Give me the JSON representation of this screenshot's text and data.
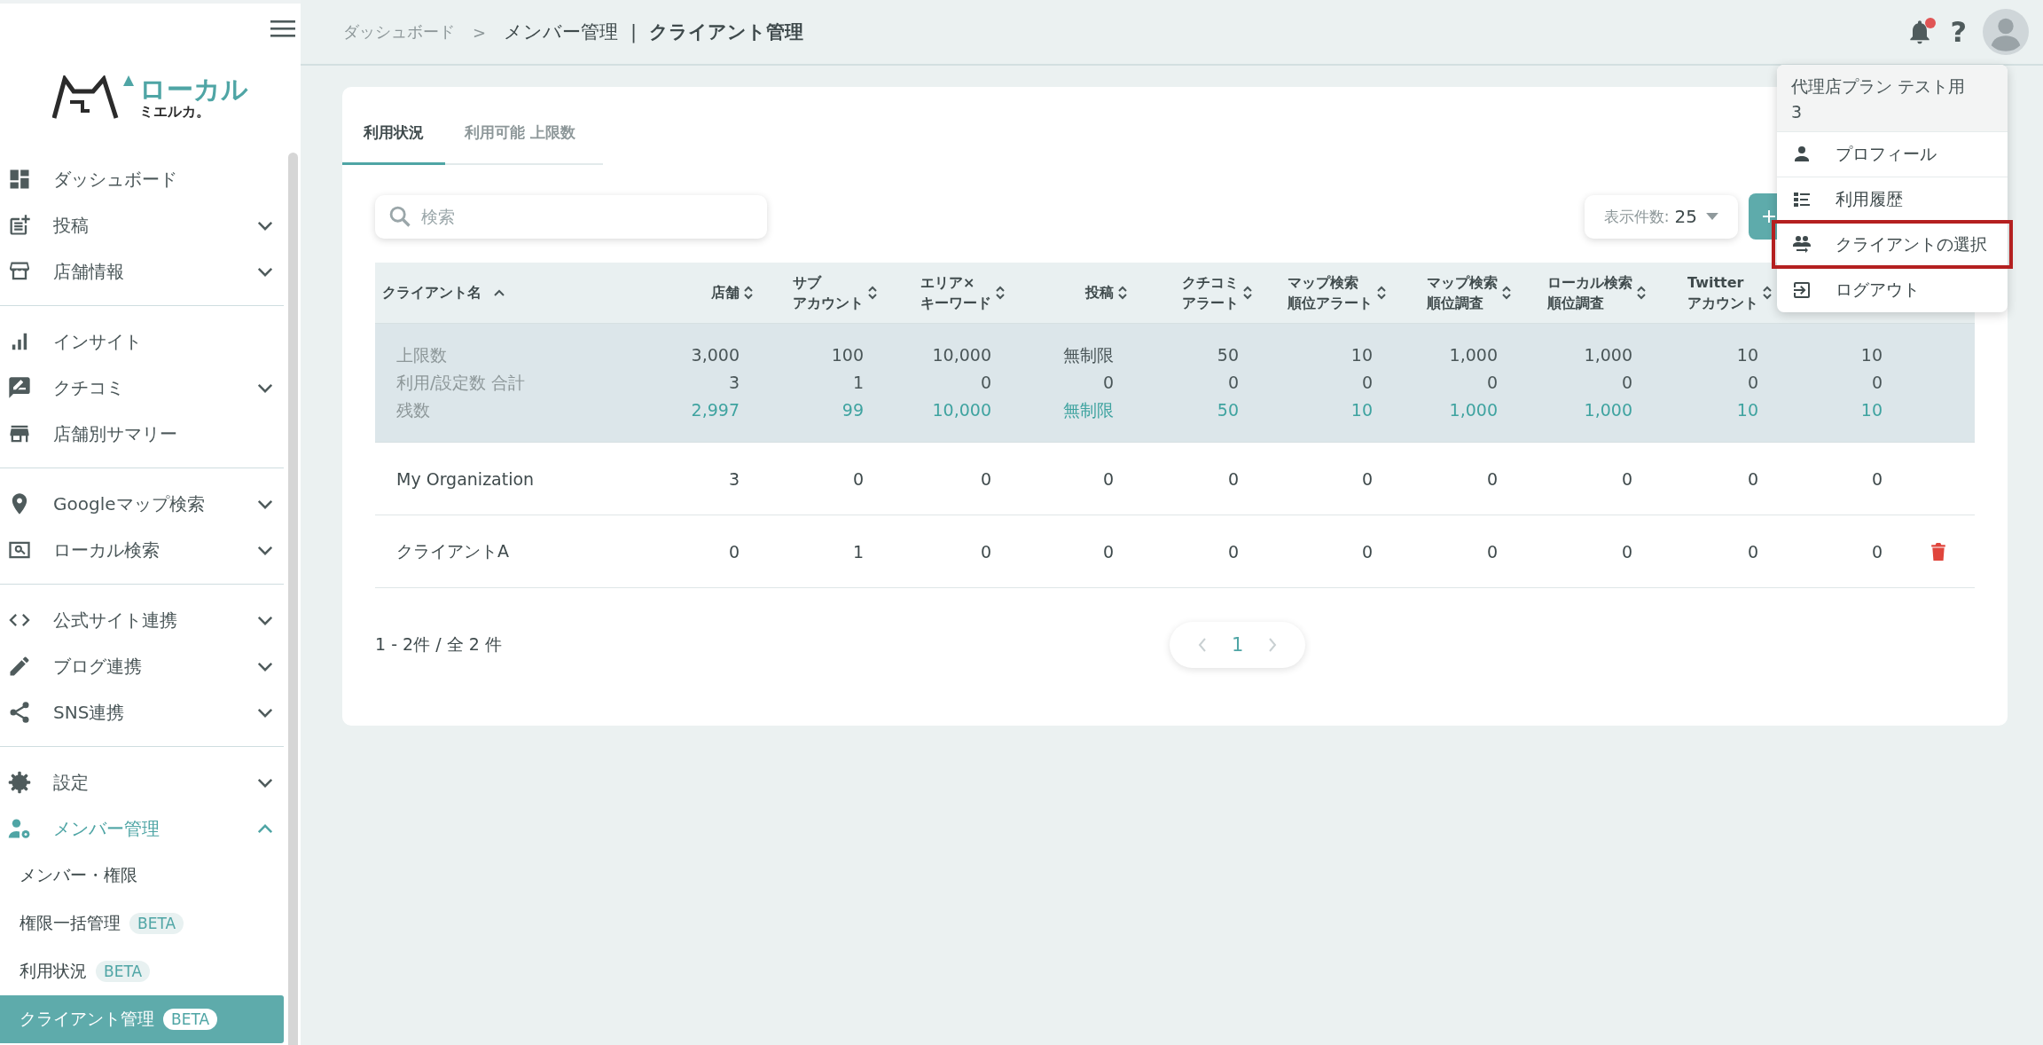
{
  "sidebar": {
    "logo": {
      "line1": "ローカル",
      "line2": "ミエルカ。"
    },
    "groups": [
      [
        {
          "label": "ダッシュボード",
          "expandable": false,
          "selected": false
        },
        {
          "label": "投稿",
          "expandable": true,
          "expanded": false,
          "selected": false
        },
        {
          "label": "店舗情報",
          "expandable": true,
          "expanded": false,
          "selected": false
        }
      ],
      [
        {
          "label": "インサイト",
          "expandable": false,
          "selected": false
        },
        {
          "label": "クチコミ",
          "expandable": true,
          "expanded": false,
          "selected": false
        },
        {
          "label": "店舗別サマリー",
          "expandable": false,
          "selected": false
        }
      ],
      [
        {
          "label": "Googleマップ検索",
          "expandable": true,
          "expanded": false,
          "selected": false
        },
        {
          "label": "ローカル検索",
          "expandable": true,
          "expanded": false,
          "selected": false
        }
      ],
      [
        {
          "label": "公式サイト連携",
          "expandable": true,
          "expanded": false,
          "selected": false
        },
        {
          "label": "ブログ連携",
          "expandable": true,
          "expanded": false,
          "selected": false
        },
        {
          "label": "SNS連携",
          "expandable": true,
          "expanded": false,
          "selected": false
        }
      ],
      [
        {
          "label": "設定",
          "expandable": true,
          "expanded": false,
          "selected": false
        },
        {
          "label": "メンバー管理",
          "expandable": true,
          "expanded": true,
          "selected": true,
          "children": [
            {
              "label": "メンバー・権限",
              "selected": false
            },
            {
              "label": "権限一括管理",
              "badge": "BETA",
              "selected": false
            },
            {
              "label": "利用状況",
              "badge": "BETA",
              "selected": false
            },
            {
              "label": "クライアント管理",
              "badge": "BETA",
              "selected": true
            }
          ]
        }
      ]
    ]
  },
  "header": {
    "breadcrumb": [
      "ダッシュボード",
      "メンバー管理"
    ],
    "separator": ">",
    "divider": "|",
    "title": "クライアント管理",
    "help": "?",
    "notifications_unread": true
  },
  "user_menu": {
    "account": "代理店プラン テスト用\n3",
    "items": [
      {
        "label": "プロフィール",
        "highlighted": false
      },
      {
        "label": "利用履歴",
        "highlighted": false
      },
      {
        "label": "クライアントの選択",
        "highlighted": true
      },
      {
        "label": "ログアウト",
        "highlighted": false
      }
    ]
  },
  "tabs": [
    {
      "label": "利用状況",
      "selected": true
    },
    {
      "label": "利用可能 上限数",
      "selected": false
    }
  ],
  "search": {
    "placeholder": "検索"
  },
  "page_size": {
    "label": "表示件数:",
    "value": "25"
  },
  "table": {
    "columns": [
      {
        "lines": [
          "クライアント名"
        ],
        "sorted": true
      },
      {
        "lines": [
          "店舗"
        ],
        "sorted": false
      },
      {
        "lines": [
          "サブ",
          "アカウント"
        ],
        "sorted": false
      },
      {
        "lines": [
          "エリア×",
          "キーワード"
        ],
        "sorted": false
      },
      {
        "lines": [
          "投稿"
        ],
        "sorted": false
      },
      {
        "lines": [
          "クチコミ",
          "アラート"
        ],
        "sorted": false
      },
      {
        "lines": [
          "マップ検索",
          "順位アラート"
        ],
        "sorted": false
      },
      {
        "lines": [
          "マップ検索",
          "順位調査"
        ],
        "sorted": false
      },
      {
        "lines": [
          "ローカル検索",
          "順位調査"
        ],
        "sorted": false
      },
      {
        "lines": [
          "Twitter",
          "アカウント"
        ],
        "sorted": false
      }
    ],
    "summary": [
      {
        "kind": "limit",
        "label": "上限数",
        "values": [
          "3,000",
          "100",
          "10,000",
          "無制限",
          "50",
          "10",
          "1,000",
          "1,000",
          "10",
          "10"
        ]
      },
      {
        "kind": "used",
        "label": "利用/設定数 合計",
        "values": [
          "3",
          "1",
          "0",
          "0",
          "0",
          "0",
          "0",
          "0",
          "0",
          "0"
        ]
      },
      {
        "kind": "remaining",
        "label": "残数",
        "values": [
          "2,997",
          "99",
          "10,000",
          "無制限",
          "50",
          "10",
          "1,000",
          "1,000",
          "10",
          "10"
        ]
      }
    ],
    "rows": [
      {
        "name": "My Organization",
        "values": [
          "3",
          "0",
          "0",
          "0",
          "0",
          "0",
          "0",
          "0",
          "0",
          "0"
        ]
      },
      {
        "name": "クライアントA",
        "values": [
          "0",
          "1",
          "0",
          "0",
          "0",
          "0",
          "0",
          "0",
          "0",
          "0"
        ],
        "deletable": true
      }
    ]
  },
  "footer": {
    "count": "1 - 2件 / 全 2 件",
    "pages": [
      {
        "label": "1",
        "selected": true
      }
    ]
  }
}
